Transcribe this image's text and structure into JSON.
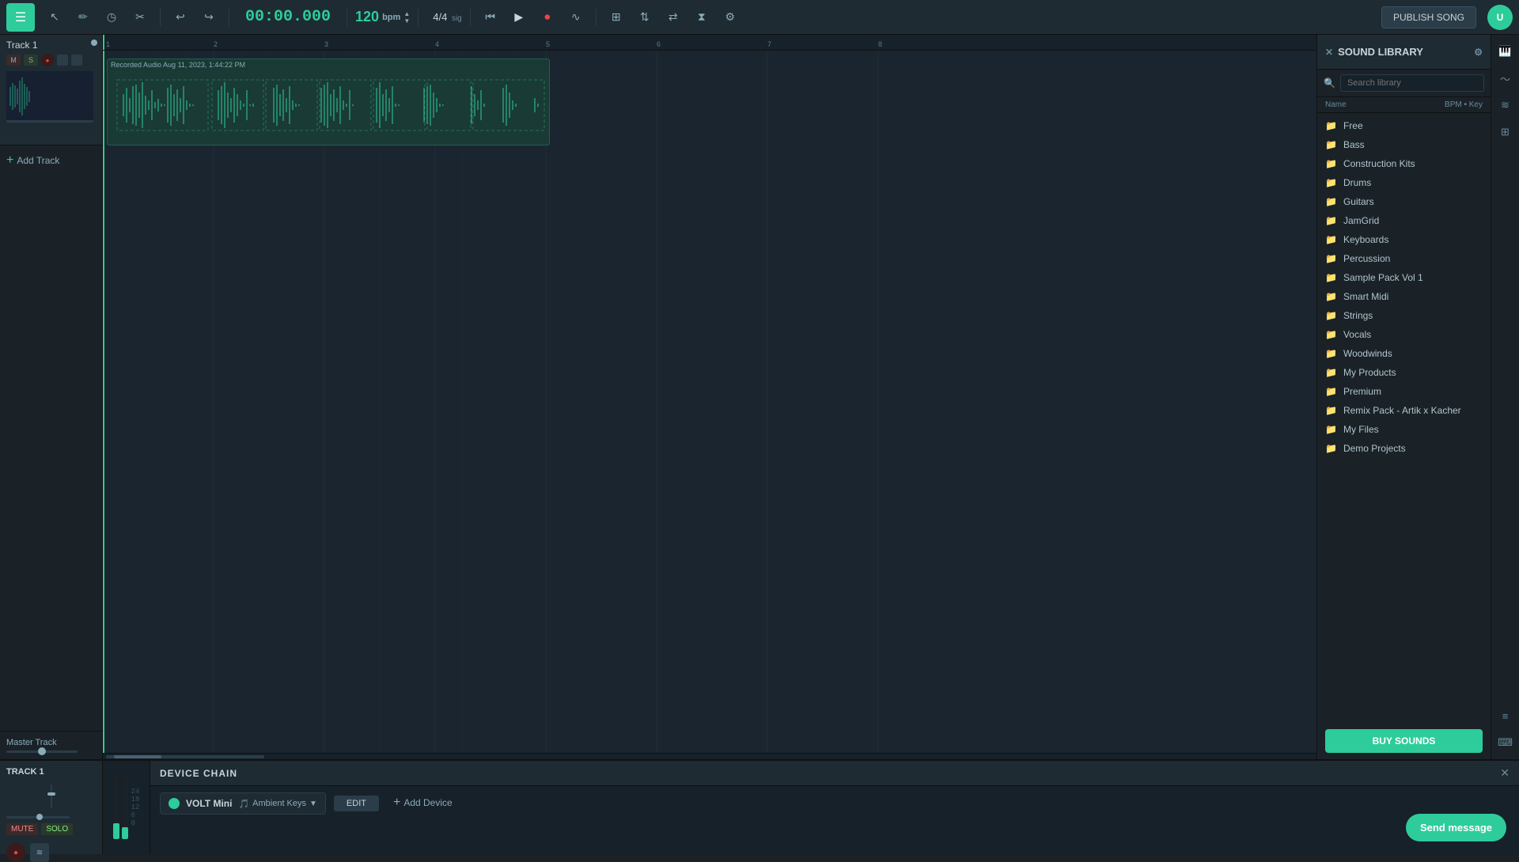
{
  "toolbar": {
    "menu_label": "☰",
    "time_display": "00:00.000",
    "bpm_value": "120",
    "bpm_label": "bpm",
    "time_sig": "4/4",
    "time_sig_label": "sig",
    "publish_label": "PUBLISH SONG",
    "tools": [
      {
        "name": "select-tool",
        "icon": "↖",
        "label": "Select"
      },
      {
        "name": "draw-tool",
        "icon": "✏",
        "label": "Draw"
      },
      {
        "name": "clock-tool",
        "icon": "◷",
        "label": "Clock"
      },
      {
        "name": "cut-tool",
        "icon": "✂",
        "label": "Cut"
      },
      {
        "name": "undo-tool",
        "icon": "↩",
        "label": "Undo"
      },
      {
        "name": "redo-tool",
        "icon": "↪",
        "label": "Redo"
      },
      {
        "name": "rewind-tool",
        "icon": "⏮",
        "label": "Rewind"
      },
      {
        "name": "play-tool",
        "icon": "▶",
        "label": "Play"
      },
      {
        "name": "record-tool",
        "icon": "⏺",
        "label": "Record"
      },
      {
        "name": "loop-tool",
        "icon": "⟳",
        "label": "Loop"
      },
      {
        "name": "snap-tool",
        "icon": "⊞",
        "label": "Snap"
      },
      {
        "name": "split-tool",
        "icon": "⇅",
        "label": "Split"
      },
      {
        "name": "merge-tool",
        "icon": "⇄",
        "label": "Merge"
      },
      {
        "name": "fx-tool",
        "icon": "⧖",
        "label": "FX"
      },
      {
        "name": "plugins-tool",
        "icon": "⚙",
        "label": "Plugins"
      }
    ]
  },
  "track1": {
    "name": "Track 1",
    "label_m": "M",
    "label_s": "S",
    "clip_label": "Recorded Audio Aug 11, 2023, 1:44:22 PM"
  },
  "add_track": {
    "label": "Add Track",
    "icon": "+"
  },
  "master_track": {
    "label": "Master Track"
  },
  "timeline": {
    "markers": [
      "1",
      "2",
      "3",
      "4",
      "5",
      "6",
      "7",
      "8"
    ]
  },
  "sound_library": {
    "title": "SOUND LIBRARY",
    "search_placeholder": "Search library",
    "cols": {
      "name": "Name",
      "bpm": "BPM",
      "key": "Key"
    },
    "items": [
      {
        "name": "Free",
        "type": "folder"
      },
      {
        "name": "Bass",
        "type": "folder"
      },
      {
        "name": "Construction Kits",
        "type": "folder"
      },
      {
        "name": "Drums",
        "type": "folder"
      },
      {
        "name": "Guitars",
        "type": "folder"
      },
      {
        "name": "JamGrid",
        "type": "folder"
      },
      {
        "name": "Keyboards",
        "type": "folder"
      },
      {
        "name": "Percussion",
        "type": "folder"
      },
      {
        "name": "Sample Pack Vol 1",
        "type": "folder"
      },
      {
        "name": "Smart Midi",
        "type": "folder"
      },
      {
        "name": "Strings",
        "type": "folder"
      },
      {
        "name": "Vocals",
        "type": "folder"
      },
      {
        "name": "Woodwinds",
        "type": "folder"
      },
      {
        "name": "My Products",
        "type": "folder"
      },
      {
        "name": "Premium",
        "type": "folder"
      },
      {
        "name": "Remix Pack - Artik x Kacher",
        "type": "folder"
      },
      {
        "name": "My Files",
        "type": "folder"
      },
      {
        "name": "Demo Projects",
        "type": "folder"
      }
    ],
    "buy_sounds_label": "BUY SOUNDS"
  },
  "device_chain": {
    "title": "DEVICE CHAIN",
    "device_name": "VOLT Mini",
    "preset_name": "Ambient Keys",
    "edit_label": "EDIT",
    "add_device_label": "Add Device",
    "close_icon": "✕"
  },
  "bottom_track": {
    "name": "TRACK 1",
    "mute_label": "MUTE",
    "solo_label": "SOLO"
  },
  "send_message": {
    "label": "Send message"
  }
}
